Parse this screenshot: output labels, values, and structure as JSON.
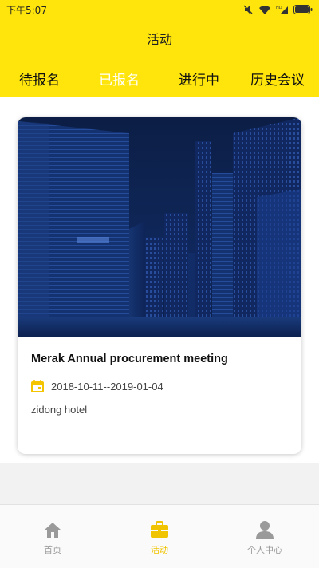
{
  "status_bar": {
    "time": "下午5:07"
  },
  "header": {
    "title": "活动",
    "background_color": "#ffe50c"
  },
  "tabs": [
    {
      "label": "待报名",
      "active": false
    },
    {
      "label": "已报名",
      "active": true
    },
    {
      "label": "进行中",
      "active": false
    },
    {
      "label": "历史会议",
      "active": false
    }
  ],
  "event_card": {
    "title": "Merak Annual procurement meeting",
    "date_range": "2018-10-11--2019-01-04",
    "location": "zidong hotel",
    "image_icon": "city-night-image",
    "date_icon": "calendar-icon"
  },
  "bottom_nav": {
    "items": [
      {
        "label": "首页",
        "icon": "home-icon",
        "active": false
      },
      {
        "label": "活动",
        "icon": "briefcase-icon",
        "active": true
      },
      {
        "label": "个人中心",
        "icon": "person-icon",
        "active": false
      }
    ],
    "active_color": "#f0c400",
    "inactive_color": "#999999"
  }
}
